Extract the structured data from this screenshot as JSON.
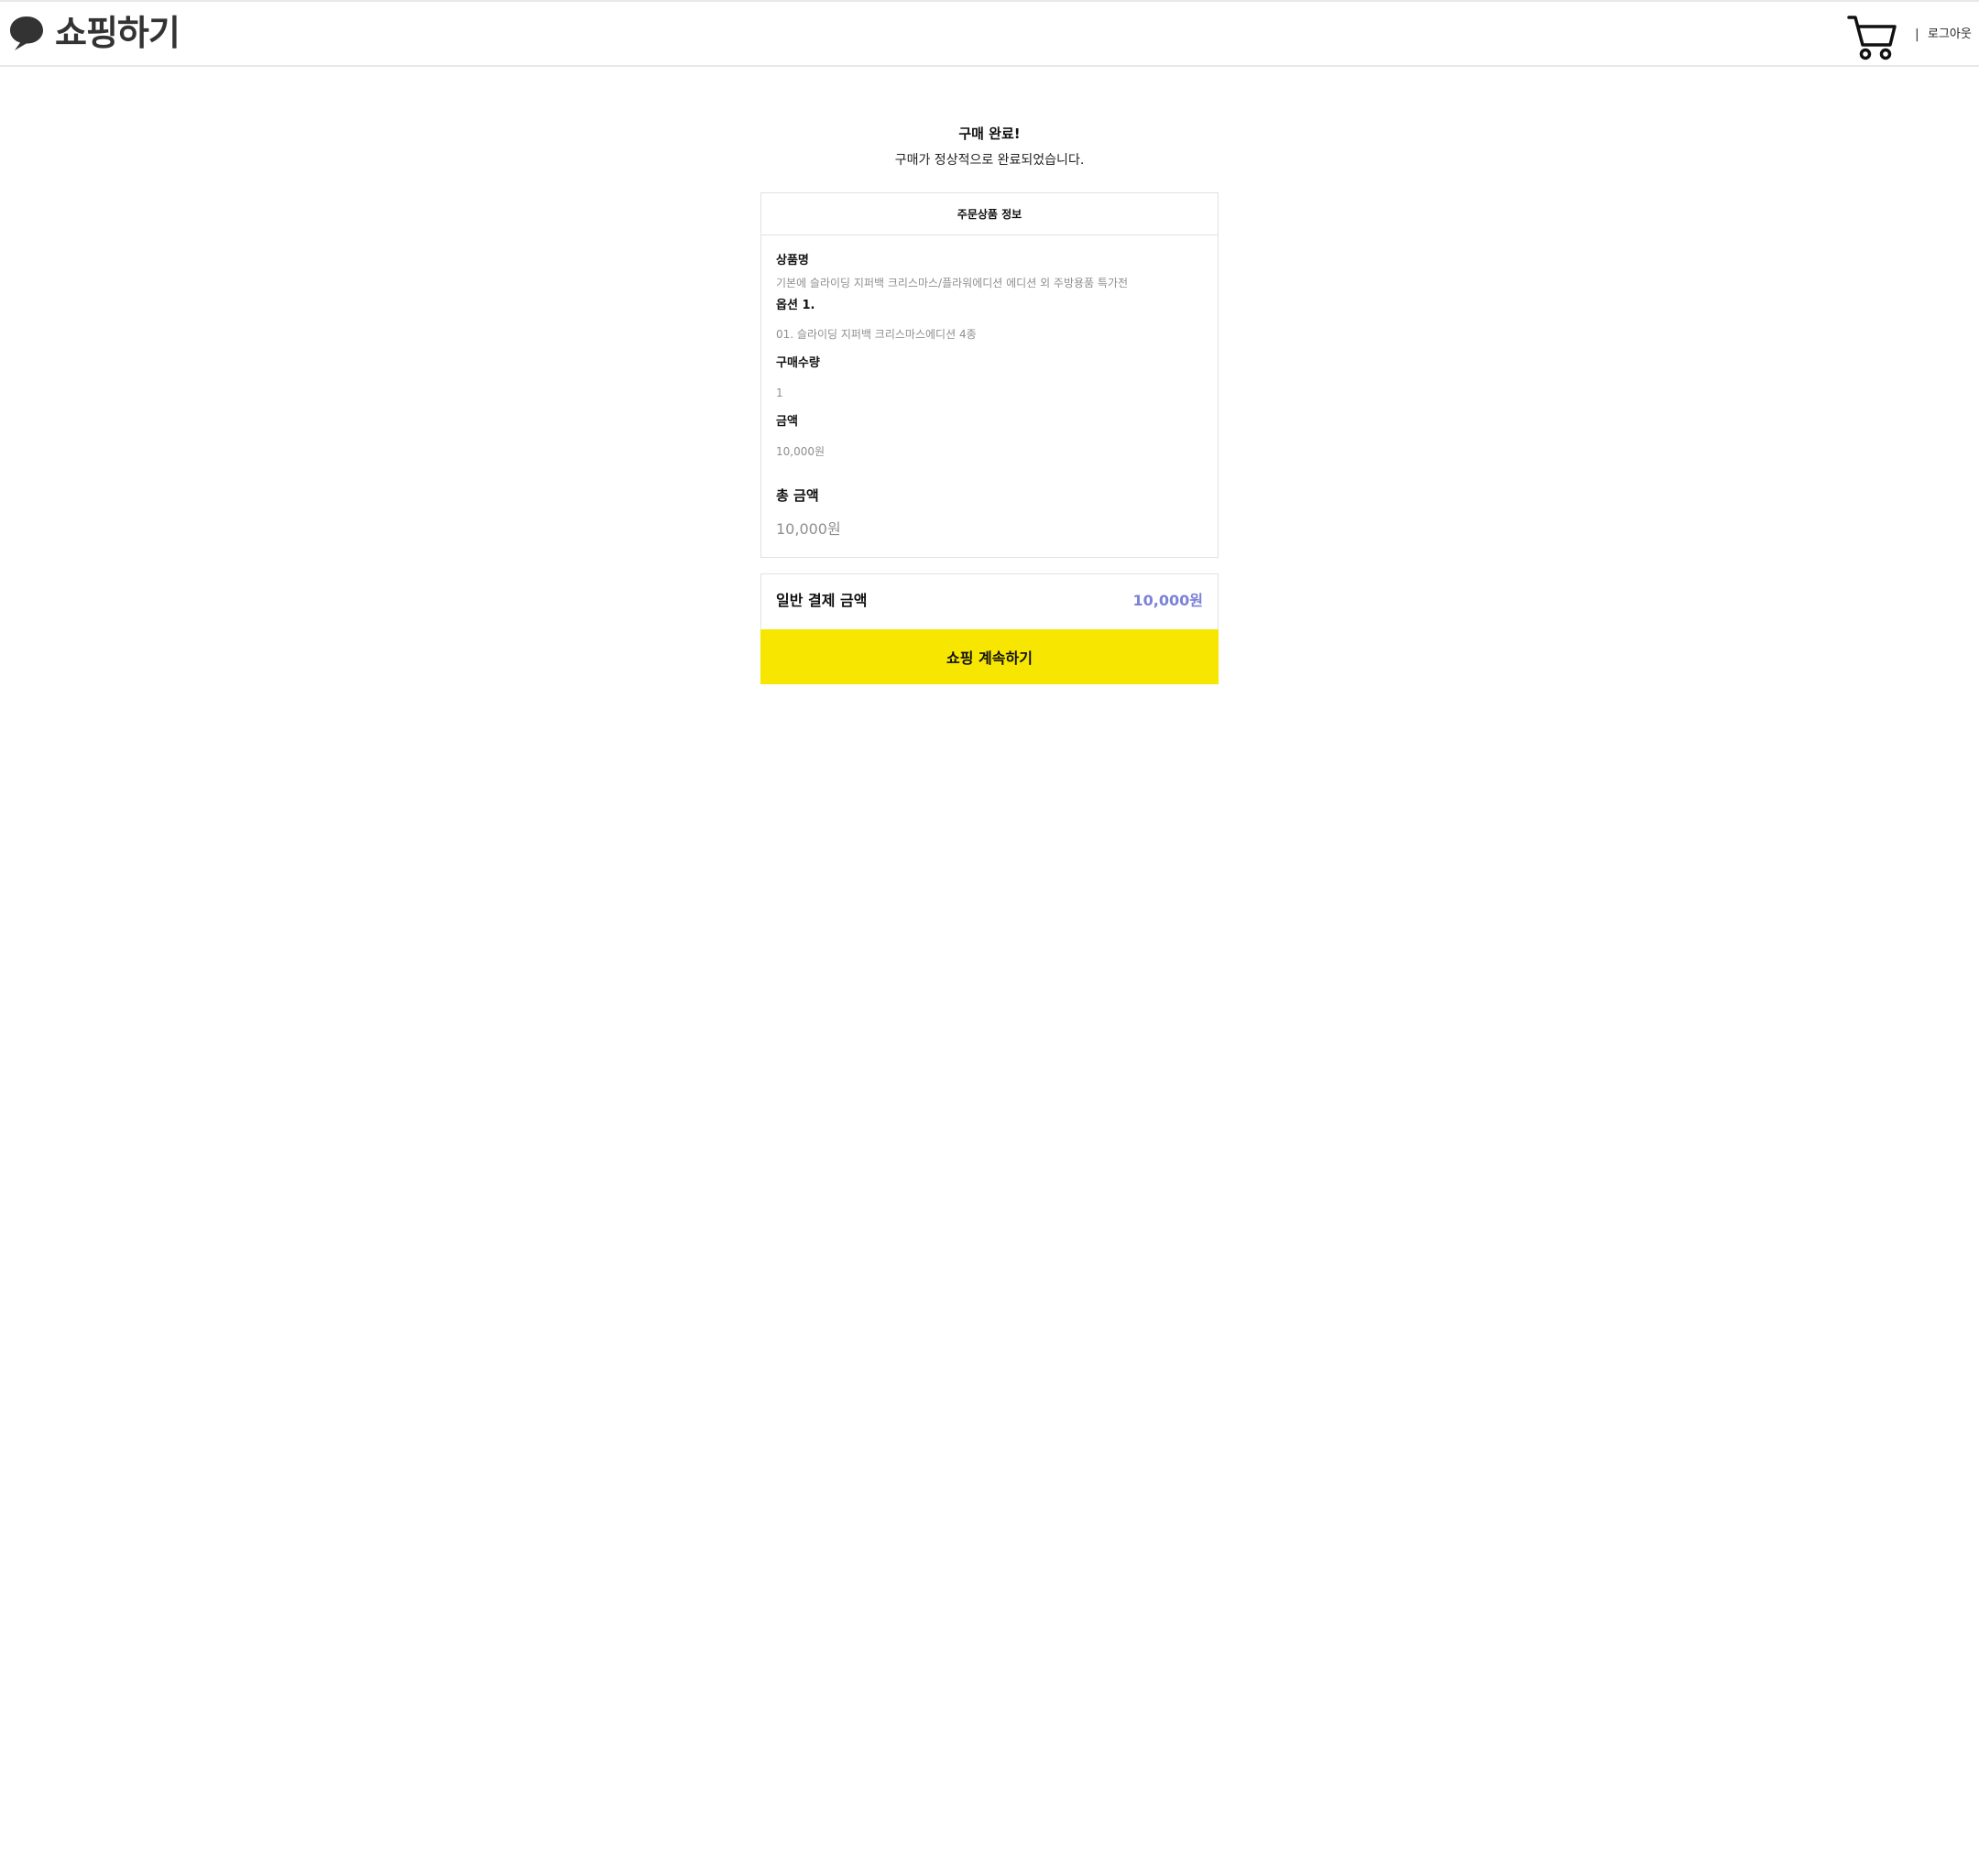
{
  "header": {
    "logo_icon": "speech-bubble-icon",
    "logo_text": "쇼핑하기",
    "cart_icon": "shopping-cart-icon",
    "separator": "|",
    "logout_label": "로그아웃"
  },
  "completion": {
    "title": "구매 완료!",
    "subtitle": "구매가 정상적으로 완료되었습니다."
  },
  "order_info": {
    "heading": "주문상품 정보",
    "product_name_label": "상품명",
    "product_name_value": "기본에 슬라이딩 지퍼백 크리스마스/플라워에디션 에디션 외 주방용품 특가전",
    "option_label": "옵션 1.",
    "option_value": "01. 슬라이딩 지퍼백 크리스마스에디션 4종",
    "quantity_label": "구매수량",
    "quantity_value": "1",
    "price_label": "금액",
    "price_value": "10,000원",
    "total_label": "총 금액",
    "total_value": "10,000원"
  },
  "payment": {
    "label": "일반 결제 금액",
    "amount": "10,000원",
    "amount_color": "#7b82d6"
  },
  "actions": {
    "continue_label": "쇼핑 계속하기",
    "continue_color": "#f7e600"
  }
}
